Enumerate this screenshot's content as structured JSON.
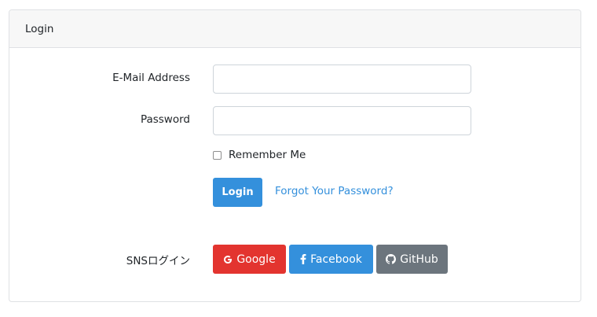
{
  "card": {
    "header_title": "Login"
  },
  "form": {
    "email_label": "E-Mail Address",
    "email_value": "",
    "password_label": "Password",
    "password_value": "",
    "remember_label": "Remember Me",
    "remember_checked": false,
    "login_button": "Login",
    "forgot_link": "Forgot Your Password?"
  },
  "sns": {
    "label": "SNSログイン",
    "buttons": [
      {
        "label": "Google",
        "icon": "google-icon",
        "color": "#e3342f"
      },
      {
        "label": "Facebook",
        "icon": "facebook-icon",
        "color": "#3490dc"
      },
      {
        "label": "GitHub",
        "icon": "github-icon",
        "color": "#6c757d"
      }
    ]
  },
  "colors": {
    "primary": "#3490dc",
    "danger": "#e3342f",
    "secondary": "#6c757d"
  }
}
